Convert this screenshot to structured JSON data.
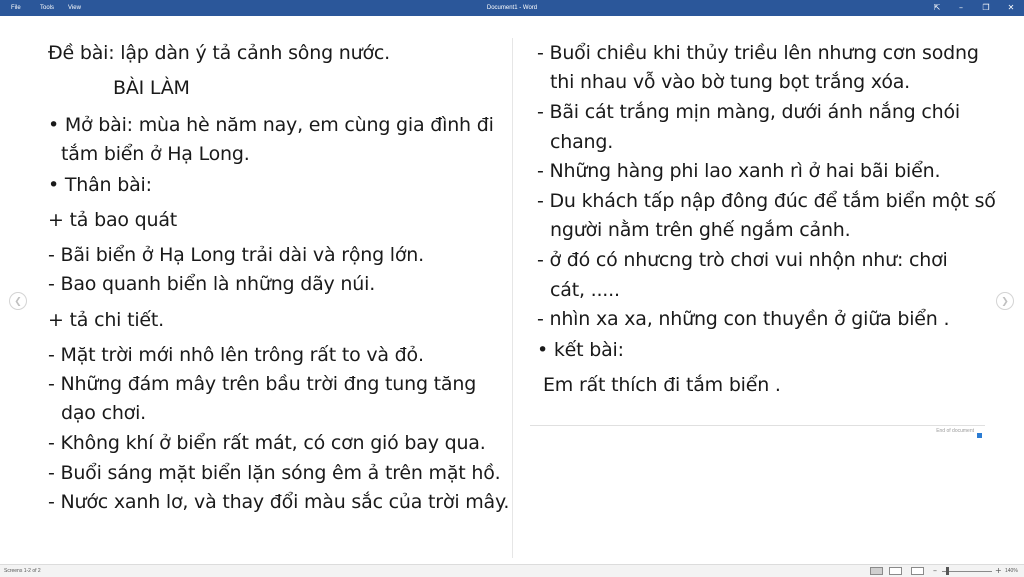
{
  "window": {
    "menu": [
      "File",
      "Tools",
      "View"
    ],
    "title": "Document1 - Word",
    "buttons": {
      "fit": "⇱",
      "minimize": "–",
      "restore": "❐",
      "close": "✕"
    }
  },
  "document": {
    "left_column": [
      "Đề bài: lập dàn ý tả cảnh sông nước.",
      "BÀI LÀM",
      "• Mở bài: mùa hè năm nay, em cùng gia đình đi",
      "tắm biển ở Hạ Long.",
      "• Thân bài:",
      "+ tả bao quát",
      "- Bãi biển ở Hạ Long trải dài và rộng lớn.",
      "- Bao quanh biển là những dãy núi.",
      "+ tả chi tiết.",
      "- Mặt trời mới nhô lên trông rất to và đỏ.",
      "- Những đám mây trên bầu trời đng tung tăng",
      "dạo chơi.",
      "- Không khí ở biển rất mát, có cơn gió bay qua.",
      "- Buổi sáng mặt biển lặn sóng êm ả trên mặt hồ.",
      "- Nước xanh lơ, và thay đổi màu sắc của trời mây."
    ],
    "right_column": [
      "- Buổi chiều khi thủy triều lên nhưng cơn sodng",
      "thi nhau vỗ vào bờ tung bọt trắng xóa.",
      "- Bãi cát trắng mịn màng, dưới ánh nắng chói",
      "chang.",
      "- Những hàng phi lao xanh rì ở hai bãi biển.",
      "- Du khách tấp nập đông đúc để tắm biển một số",
      "người nằm trên ghế ngắm cảnh.",
      "- ở đó có nhưcng trò chơi vui nhộn như: chơi",
      "cát, .....",
      "- nhìn xa xa, những con thuyền ở giữa biển .",
      "• kết bài:",
      "Em  rất thích đi tắm biển ."
    ],
    "end_label": "End of document",
    "nav": {
      "prev": "❮",
      "next": "❯"
    }
  },
  "statusbar": {
    "screens": "Screens 1-2 of 2",
    "zoom_minus": "–",
    "zoom_plus": "+",
    "zoom": "140%"
  },
  "colors": {
    "titlebar": "#2b579a",
    "end_marker": "#2b7cd3"
  }
}
